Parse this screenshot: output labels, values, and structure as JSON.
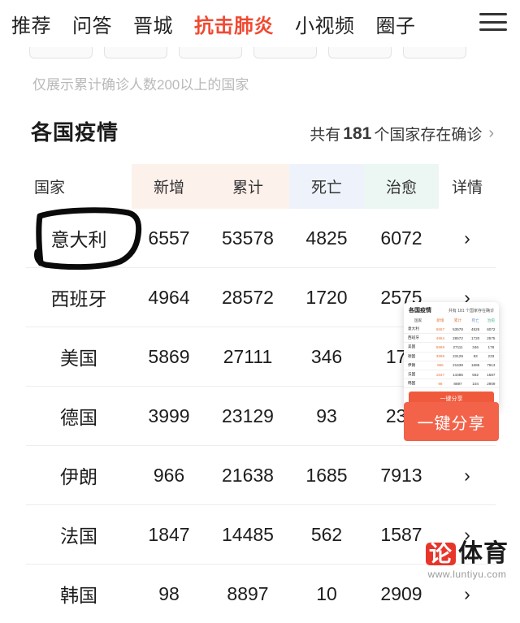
{
  "topnav": {
    "items": [
      {
        "label": "推荐",
        "active": false
      },
      {
        "label": "问答",
        "active": false
      },
      {
        "label": "晋城",
        "active": false
      },
      {
        "label": "抗击肺炎",
        "active": true
      },
      {
        "label": "小视频",
        "active": false
      },
      {
        "label": "圈子",
        "active": false
      }
    ],
    "menu_icon": "hamburger-menu-icon"
  },
  "note": "仅展示累计确诊人数200以上的国家",
  "section": {
    "title": "各国疫情",
    "sub_prefix": "共有",
    "sub_count": "181",
    "sub_suffix": "个国家存在确诊",
    "chevron": "›"
  },
  "table": {
    "headers": [
      "国家",
      "新增",
      "累计",
      "死亡",
      "治愈",
      "详情"
    ],
    "rows": [
      {
        "country": "意大利",
        "new": "6557",
        "total": "53578",
        "death": "4825",
        "cured": "6072",
        "arrow": "›"
      },
      {
        "country": "西班牙",
        "new": "4964",
        "total": "28572",
        "death": "1720",
        "cured": "2575",
        "arrow": "›"
      },
      {
        "country": "美国",
        "new": "5869",
        "total": "27111",
        "death": "346",
        "cured": "178",
        "arrow": "›"
      },
      {
        "country": "德国",
        "new": "3999",
        "total": "23129",
        "death": "93",
        "cured": "233",
        "arrow": "›"
      },
      {
        "country": "伊朗",
        "new": "966",
        "total": "21638",
        "death": "1685",
        "cured": "7913",
        "arrow": "›"
      },
      {
        "country": "法国",
        "new": "1847",
        "total": "14485",
        "death": "562",
        "cured": "1587",
        "arrow": "›"
      },
      {
        "country": "韩国",
        "new": "98",
        "total": "8897",
        "death": "10",
        "cured": "2909",
        "arrow": "›"
      }
    ]
  },
  "share_card": {
    "title": "各国疫情",
    "subtitle": "共有 181 个国家存在确诊",
    "headers": [
      "国家",
      "新增",
      "累计",
      "死亡",
      "治愈"
    ],
    "rows": [
      {
        "country": "意大利",
        "new": "6557",
        "total": "53578",
        "death": "4825",
        "cured": "6072"
      },
      {
        "country": "西班牙",
        "new": "4964",
        "total": "28572",
        "death": "1720",
        "cured": "2575"
      },
      {
        "country": "美国",
        "new": "5869",
        "total": "27111",
        "death": "346",
        "cured": "178"
      },
      {
        "country": "德国",
        "new": "3999",
        "total": "23129",
        "death": "93",
        "cured": "233"
      },
      {
        "country": "伊朗",
        "new": "966",
        "total": "21638",
        "death": "1685",
        "cured": "7913"
      },
      {
        "country": "法国",
        "new": "1847",
        "total": "14485",
        "death": "562",
        "cured": "1587"
      },
      {
        "country": "韩国",
        "new": "98",
        "total": "8897",
        "death": "104",
        "cured": "2909"
      }
    ],
    "button_label": "一键分享"
  },
  "share_button_label": "一键分享",
  "watermark": {
    "badge": "论",
    "text": "体育",
    "url": "www.luntiyu.com"
  },
  "colors": {
    "accent_orange": "#e8743b",
    "active_nav": "#f04a32",
    "death_blue": "#5c8ed6",
    "cured_green": "#3fae8d",
    "share_red": "#f2634a"
  }
}
